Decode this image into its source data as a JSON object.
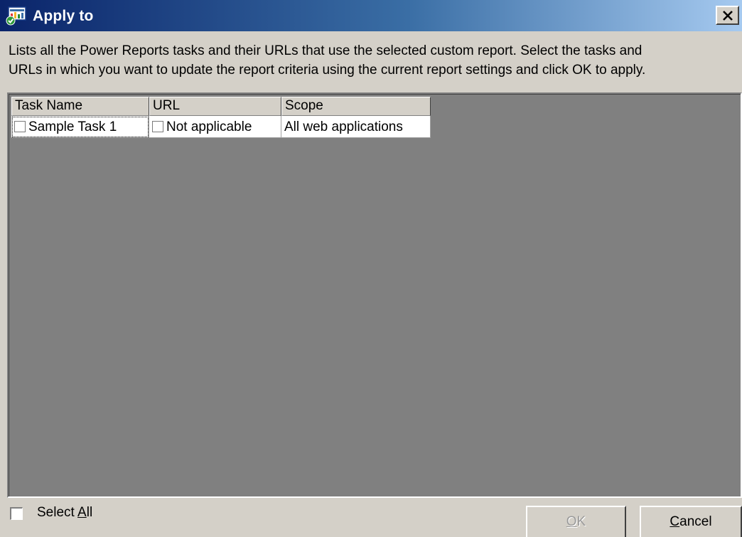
{
  "window": {
    "title": "Apply to",
    "title_icon": "apply-report-icon",
    "close_icon": "close-icon"
  },
  "description": {
    "line1": "Lists all the Power Reports tasks and their URLs that use the selected custom report. Select the tasks and",
    "line2": "URLs in which you want to update the report criteria using the current report settings and click OK to apply."
  },
  "table": {
    "columns": [
      "Task Name",
      "URL",
      "Scope"
    ],
    "rows": [
      {
        "task_name": "Sample Task 1",
        "task_checked": false,
        "url": "Not applicable",
        "url_checked": false,
        "scope": "All web applications"
      }
    ]
  },
  "footer": {
    "select_all": {
      "prefix": "Select ",
      "mnemonic": "A",
      "suffix": "ll",
      "checked": false
    },
    "ok": {
      "mnemonic": "O",
      "rest": "K",
      "enabled": false
    },
    "cancel": {
      "mnemonic": "C",
      "rest": "ancel"
    }
  },
  "colors": {
    "title_gradient_start": "#0a246a",
    "title_gradient_end": "#a6caf0",
    "dialog_face": "#d4d0c8",
    "grid_background": "#808080"
  }
}
